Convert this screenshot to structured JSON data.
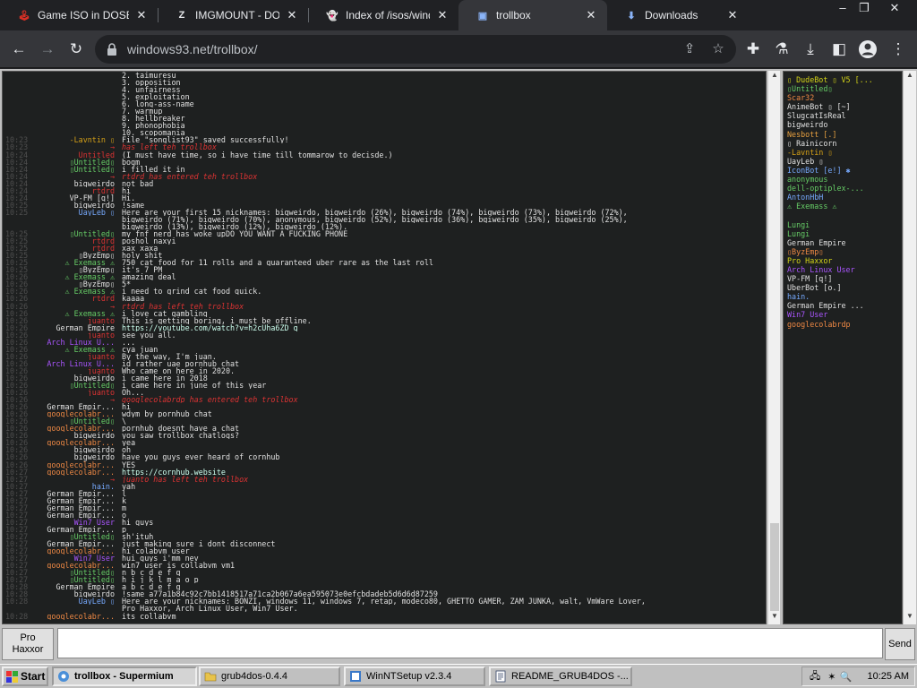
{
  "tabs": [
    {
      "label": "Game ISO in DOSB",
      "icon": "joystick-icon",
      "color": "#d93025"
    },
    {
      "label": "IMGMOUNT - DOSB",
      "icon": "z-icon",
      "color": "#e8eaed"
    },
    {
      "label": "Index of /isos/wind",
      "icon": "ghost-icon",
      "color": "#e8eaed"
    },
    {
      "label": "trollbox",
      "icon": "trollbox-icon",
      "color": "#8ab4f8"
    },
    {
      "label": "Downloads",
      "icon": "download-icon",
      "color": "#8ab4f8"
    }
  ],
  "window_controls": {
    "minimize": "–",
    "restore": "❐",
    "close": "✕"
  },
  "toolbar": {
    "url": "windows93.net/trollbox/"
  },
  "chat": [
    {
      "t": "",
      "n": "",
      "c": "#fff",
      "m": "2. taimuresu"
    },
    {
      "t": "",
      "n": "",
      "c": "#fff",
      "m": "3. opposition"
    },
    {
      "t": "",
      "n": "",
      "c": "#fff",
      "m": "4. unfairness"
    },
    {
      "t": "",
      "n": "",
      "c": "#fff",
      "m": "5. exploitation"
    },
    {
      "t": "",
      "n": "",
      "c": "#fff",
      "m": "6. long-ass-name"
    },
    {
      "t": "",
      "n": "",
      "c": "#fff",
      "m": "7. warmup"
    },
    {
      "t": "",
      "n": "",
      "c": "#fff",
      "m": "8. hellbreaker"
    },
    {
      "t": "",
      "n": "",
      "c": "#fff",
      "m": "9. phonophobia"
    },
    {
      "t": "",
      "n": "",
      "c": "#fff",
      "m": "10. scopomania"
    },
    {
      "t": "10:23",
      "n": "-Lavntin ▯",
      "c": "#d4a017",
      "m": "File \"songlist93\" saved successfully!"
    },
    {
      "t": "10:23",
      "n": "→",
      "c": "#d33",
      "m": "has left teh trollbox",
      "s": 1
    },
    {
      "t": "10:24",
      "n": "Untitled",
      "c": "#d33",
      "m": "(I must have time, so i have time till tommarow to decisde.)"
    },
    {
      "t": "10:24",
      "n": "▯Untitled▯",
      "c": "#6c6",
      "m": "bogm"
    },
    {
      "t": "10:24",
      "n": "▯Untitled▯",
      "c": "#6c6",
      "m": "i filled it in"
    },
    {
      "t": "10:24",
      "n": "→",
      "c": "#d33",
      "m": "rtdrd has entered teh trollbox",
      "s": 1
    },
    {
      "t": "10:24",
      "n": "bigweirdo",
      "c": "#e0e0e0",
      "m": "not bad"
    },
    {
      "t": "10:24",
      "n": "rtdrd",
      "c": "#d33",
      "m": "hi"
    },
    {
      "t": "10:24",
      "n": "VP-FM [q!]",
      "c": "#e0e0e0",
      "m": "Hi."
    },
    {
      "t": "10:25",
      "n": "bigweirdo",
      "c": "#e0e0e0",
      "m": "!same"
    },
    {
      "t": "10:25",
      "n": "UayLeb ▯",
      "c": "#7af",
      "m": "Here are your first 15 nicknames: bigweirdo, bigweirdo (26%), bigweirdo (74%), bigweirdo (73%), bigweirdo (72%),"
    },
    {
      "t": "",
      "n": "",
      "c": "#fff",
      "m": "bigweirdo (71%), bigweirdo (70%), anonymous, bigweirdo (52%), bigweirdo (36%), bgiweirdo (35%), bigweirdo (25%),"
    },
    {
      "t": "",
      "n": "",
      "c": "#fff",
      "m": "bigweirdo (13%), bigweirdo (12%), bigweirdo (12%)."
    },
    {
      "t": "10:25",
      "n": "▯Untitled▯",
      "c": "#6c6",
      "m": "my fnf nerd has woke upDO YOU WANT A FUCKING PHONE"
    },
    {
      "t": "10:25",
      "n": "rtdrd",
      "c": "#d33",
      "m": "poshol naxyi"
    },
    {
      "t": "10:25",
      "n": "rtdrd",
      "c": "#d33",
      "m": "xax xaxa"
    },
    {
      "t": "10:25",
      "n": "▯ByzEmp▯",
      "c": "#e0e0e0",
      "m": "holy shit"
    },
    {
      "t": "10:25",
      "n": "⚠ Exemass ⚠",
      "c": "#6c6",
      "m": "750 cat food for 11 rolls and a guaranteed uber rare as the last roll"
    },
    {
      "t": "10:25",
      "n": "▯ByzEmp▯",
      "c": "#e0e0e0",
      "m": "it's 7 PM"
    },
    {
      "t": "10:26",
      "n": "⚠ Exemass ⚠",
      "c": "#6c6",
      "m": "amazing deal"
    },
    {
      "t": "10:26",
      "n": "▯ByzEmp▯",
      "c": "#e0e0e0",
      "m": "5*"
    },
    {
      "t": "10:26",
      "n": "⚠ Exemass ⚠",
      "c": "#6c6",
      "m": "i need to grind cat food quick."
    },
    {
      "t": "10:26",
      "n": "rtdrd",
      "c": "#d33",
      "m": "kaaaa"
    },
    {
      "t": "10:26",
      "n": "→",
      "c": "#d33",
      "m": "rtdrd has left teh trollbox",
      "s": 1
    },
    {
      "t": "10:26",
      "n": "⚠ Exemass ⚠",
      "c": "#6c6",
      "m": "i love cat gambling"
    },
    {
      "t": "10:26",
      "n": "juanto",
      "c": "#d33",
      "m": "This is getting boring, i must be offline."
    },
    {
      "t": "10:26",
      "n": "German Empire",
      "c": "#e0e0e0",
      "m": "https://youtube.com/watch?v=h2cUha6ZD_g",
      "l": 1
    },
    {
      "t": "10:26",
      "n": "juanto",
      "c": "#d33",
      "m": "see you all."
    },
    {
      "t": "10:26",
      "n": "Arch Linux U...",
      "c": "#a5f",
      "m": "..."
    },
    {
      "t": "10:26",
      "n": "⚠ Exemass ⚠",
      "c": "#6c6",
      "m": "cya juan"
    },
    {
      "t": "10:26",
      "n": "juanto",
      "c": "#d33",
      "m": "By the way, I'm juan."
    },
    {
      "t": "10:26",
      "n": "Arch Linux U...",
      "c": "#a5f",
      "m": "id rather uae pornhub chat"
    },
    {
      "t": "10:26",
      "n": "juanto",
      "c": "#d33",
      "m": "Who came on here in 2020."
    },
    {
      "t": "10:26",
      "n": "bigweirdo",
      "c": "#e0e0e0",
      "m": "i came here in 2018"
    },
    {
      "t": "10:26",
      "n": "▯Untitled▯",
      "c": "#6c6",
      "m": "i came here in june of this year"
    },
    {
      "t": "10:26",
      "n": "juanto",
      "c": "#d33",
      "m": "Oh..."
    },
    {
      "t": "10:26",
      "n": "→",
      "c": "#d33",
      "m": "googlecolabrdp has entered teh trollbox",
      "s": 1
    },
    {
      "t": "10:26",
      "n": "German Empir...",
      "c": "#e0e0e0",
      "m": "hi"
    },
    {
      "t": "10:26",
      "n": "googlecolabr...",
      "c": "#e84",
      "m": "wdym by pornhub chat"
    },
    {
      "t": "10:26",
      "n": "▯Untitled▯",
      "c": "#6c6",
      "m": "\\"
    },
    {
      "t": "10:26",
      "n": "googlecolabr...",
      "c": "#e84",
      "m": "pornhub doesnt have a chat"
    },
    {
      "t": "10:26",
      "n": "bigweirdo",
      "c": "#e0e0e0",
      "m": "you saw trollbox chatlogs?"
    },
    {
      "t": "10:26",
      "n": "googlecolabr...",
      "c": "#e84",
      "m": "yea"
    },
    {
      "t": "10:26",
      "n": "bigweirdo",
      "c": "#e0e0e0",
      "m": "oh"
    },
    {
      "t": "10:26",
      "n": "bigweirdo",
      "c": "#e0e0e0",
      "m": "have you guys ever heard of cornhub"
    },
    {
      "t": "10:26",
      "n": "googlecolabr...",
      "c": "#e84",
      "m": "YES"
    },
    {
      "t": "10:27",
      "n": "googlecolabr...",
      "c": "#e84",
      "m": "https://cornhub.website",
      "l": 1
    },
    {
      "t": "10:27",
      "n": "→",
      "c": "#d33",
      "m": "juanto has left teh trollbox",
      "s": 1
    },
    {
      "t": "10:27",
      "n": "hain.",
      "c": "#7af",
      "m": "yah"
    },
    {
      "t": "10:27",
      "n": "German Empir...",
      "c": "#e0e0e0",
      "m": "l"
    },
    {
      "t": "10:27",
      "n": "German Empir...",
      "c": "#e0e0e0",
      "m": "k"
    },
    {
      "t": "10:27",
      "n": "German Empir...",
      "c": "#e0e0e0",
      "m": "m"
    },
    {
      "t": "10:27",
      "n": "German Empir...",
      "c": "#e0e0e0",
      "m": "o"
    },
    {
      "t": "10:27",
      "n": "Win7 User",
      "c": "#a5f",
      "m": "hi guys"
    },
    {
      "t": "10:27",
      "n": "German Empir...",
      "c": "#e0e0e0",
      "m": "p"
    },
    {
      "t": "10:27",
      "n": "▯Untitled▯",
      "c": "#6c6",
      "m": "sh'ituh"
    },
    {
      "t": "10:27",
      "n": "German Empir...",
      "c": "#e0e0e0",
      "m": "just making sure i dont disconnect"
    },
    {
      "t": "10:27",
      "n": "googlecolabr...",
      "c": "#e84",
      "m": "hi colabvm user"
    },
    {
      "t": "10:27",
      "n": "Win7 User",
      "c": "#a5f",
      "m": "hui_guys i'mm nev"
    },
    {
      "t": "10:27",
      "n": "googlecolabr...",
      "c": "#e84",
      "m": "win7 user is collabvm vm1"
    },
    {
      "t": "10:27",
      "n": "▯Untitled▯",
      "c": "#6c6",
      "m": "n b c d e f g"
    },
    {
      "t": "10:27",
      "n": "▯Untitled▯",
      "c": "#6c6",
      "m": "h i j k l m a o p"
    },
    {
      "t": "10:28",
      "n": "German Empire",
      "c": "#e0e0e0",
      "m": "a b c d e f g"
    },
    {
      "t": "10:28",
      "n": "bigweirdo",
      "c": "#e0e0e0",
      "m": "!same a77a1b84c92c7bb1418517a71ca2b067a6ea595073e0efcbdadeb5d6d6d87259"
    },
    {
      "t": "10:28",
      "n": "UayLeb ▯",
      "c": "#7af",
      "m": "Here are your nicknames: BONZI, windows 11, windows 7, retap, modeco80, GHETTO GAMER, ZAM JUNKA, walt, VmWare Lover,"
    },
    {
      "t": "",
      "n": "",
      "c": "#fff",
      "m": "Pro Haxxor, Arch Linux User, Win7 User."
    },
    {
      "t": "10:28",
      "n": "googlecolabr...",
      "c": "#e84",
      "m": "its collabvm"
    }
  ],
  "users": [
    {
      "name": "▯ DudeBot ▯ V5 [...",
      "c": "#d4d417"
    },
    {
      "name": "▯Untitled▯",
      "c": "#6c6"
    },
    {
      "name": "Scar32",
      "c": "#e84"
    },
    {
      "name": "AnimeBot ▯ [~]",
      "c": "#e0e0e0"
    },
    {
      "name": "SlugcatIsReal",
      "c": "#e0e0e0"
    },
    {
      "name": "bigweirdo",
      "c": "#e0e0e0"
    },
    {
      "name": "Nesbott [.]",
      "c": "#e8a040"
    },
    {
      "name": "▯ Rainicorn",
      "c": "#e0e0e0"
    },
    {
      "name": "-Lavntin ▯",
      "c": "#d4a017"
    },
    {
      "name": "UayLeb ▯",
      "c": "#e0e0e0"
    },
    {
      "name": "IconBot [e!] ✱",
      "c": "#7af"
    },
    {
      "name": "anonymous",
      "c": "#6c6"
    },
    {
      "name": "dell-optiplex-...",
      "c": "#6c6"
    },
    {
      "name": "AntonHbH",
      "c": "#7af"
    },
    {
      "name": "⚠ Exemass ⚠",
      "c": "#6c6"
    },
    {
      "name": "",
      "c": "#a5f"
    },
    {
      "name": "Lungi",
      "c": "#6c6"
    },
    {
      "name": "Lungi",
      "c": "#6c6"
    },
    {
      "name": "German Empire",
      "c": "#e0e0e0"
    },
    {
      "name": "▯ByzEmp▯",
      "c": "#e84"
    },
    {
      "name": "Pro Haxxor",
      "c": "#d4d417"
    },
    {
      "name": "Arch Linux User",
      "c": "#a5f"
    },
    {
      "name": "VP-FM [q!]",
      "c": "#e0e0e0"
    },
    {
      "name": "UberBot [o.]",
      "c": "#e0e0e0"
    },
    {
      "name": "hain.",
      "c": "#7af"
    },
    {
      "name": "German Empire ...",
      "c": "#e0e0e0"
    },
    {
      "name": "Win7 User",
      "c": "#a5f"
    },
    {
      "name": "googlecolabrdp",
      "c": "#e84"
    }
  ],
  "compose": {
    "nick_line1": "Pro",
    "nick_line2": "Haxxor",
    "input_value": "",
    "send_label": "Send"
  },
  "taskbar": {
    "start_label": "Start",
    "tasks": [
      {
        "label": "trollbox - Supermium",
        "icon": "browser-icon",
        "active": true
      },
      {
        "label": "grub4dos-0.4.4",
        "icon": "folder-icon",
        "active": false
      },
      {
        "label": "WinNTSetup v2.3.4",
        "icon": "setup-icon",
        "active": false
      },
      {
        "label": "README_GRUB4DOS -...",
        "icon": "notepad-icon",
        "active": false
      }
    ],
    "clock": "10:25 AM"
  }
}
